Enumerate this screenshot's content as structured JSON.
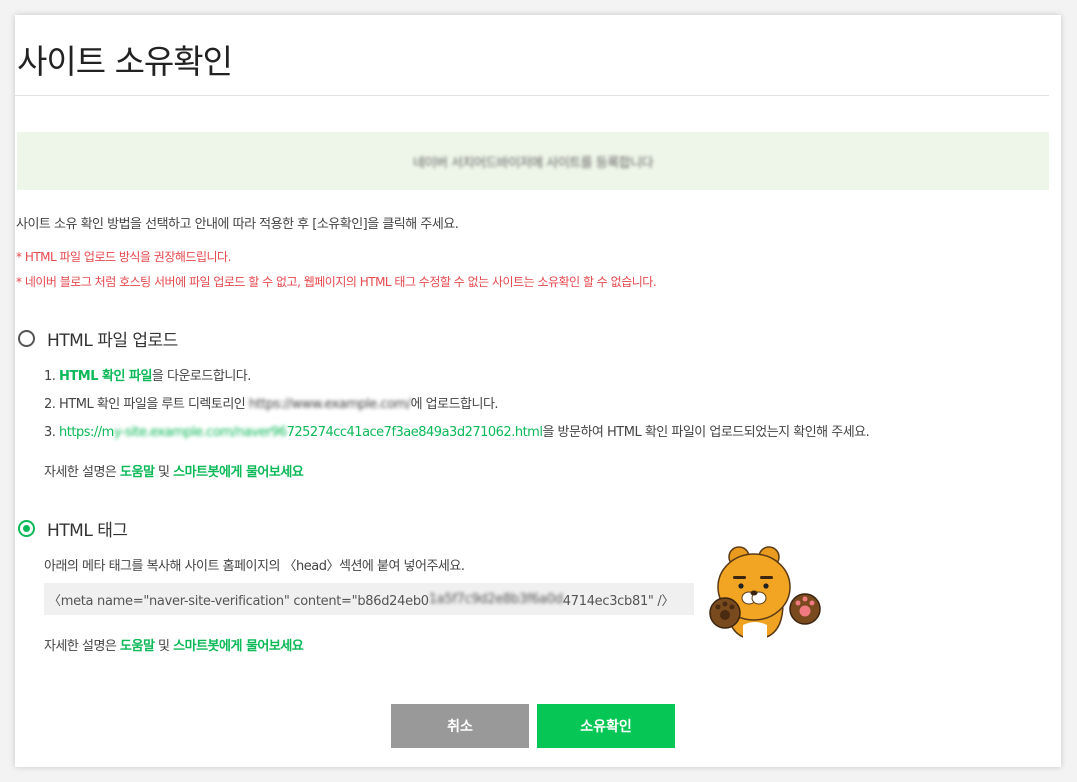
{
  "dialog": {
    "title": "사이트 소유확인",
    "notice_text": "네이버 서치어드바이저에 사이트를 등록합니다",
    "description": "사이트 소유 확인 방법을 선택하고 안내에 따라 적용한 후 [소유확인]을 클릭해 주세요.",
    "warnings": [
      "* HTML 파일 업로드 방식을 권장해드립니다.",
      "* 네이버 블로그 처럼 호스팅 서버에 파일 업로드 할 수 없고, 웹페이지의 HTML 태그 수정할 수 없는 사이트는 소유확인 할 수 없습니다."
    ]
  },
  "html_file": {
    "label": "HTML 파일 업로드",
    "selected": false,
    "step1_prefix": "1. ",
    "step1_link": "HTML 확인 파일",
    "step1_suffix": "을 다운로드합니다.",
    "step2_prefix": "2. HTML 확인 파일을 루트 디렉토리인 ",
    "step2_blurred": "https://www.example.com/",
    "step2_suffix": "에 업로드합니다.",
    "step3_prefix": "3. ",
    "step3_link_start": "https://m",
    "step3_link_blurred": "y-site.example.com/naver96",
    "step3_link_end": "725274cc41ace7f3ae849a3d271062.html",
    "step3_suffix": "을 방문하여 HTML 확인 파일이 업로드되었는지 확인해 주세요.",
    "help_prefix": "자세한 설명은 ",
    "help_link1": "도움말",
    "help_mid": " 및 ",
    "help_link2": "스마트봇에게 물어보세요"
  },
  "html_tag": {
    "label": "HTML 태그",
    "selected": true,
    "instruction": "아래의 메타 태그를 복사해 사이트 홈페이지의 〈head〉섹션에 붙여 넣어주세요.",
    "code_start": "〈meta name=\"naver-site-verification\" content=\"b86d24eb0",
    "code_blurred": "1a5f7c9d2e8b3f6a0d",
    "code_end": "4714ec3cb81\" /〉",
    "help_prefix": "자세한 설명은 ",
    "help_link1": "도움말",
    "help_mid": " 및 ",
    "help_link2": "스마트봇에게 물어보세요"
  },
  "buttons": {
    "cancel": "취소",
    "confirm": "소유확인"
  },
  "colors": {
    "accent_green": "#06c755",
    "link_green": "#0cb958",
    "warning_red": "#e5484d",
    "notice_bg": "#eef6e9",
    "cancel_gray": "#999999"
  },
  "icons": {
    "mascot": "ryan-character-icon"
  }
}
